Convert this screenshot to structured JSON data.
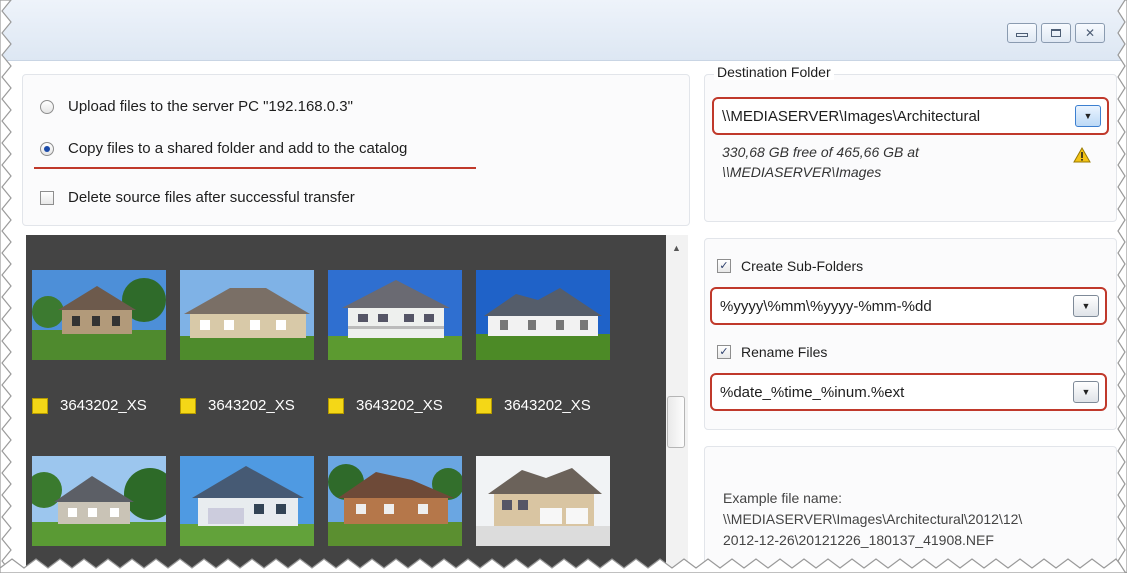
{
  "window": {
    "controls": {
      "minimize": "minimize-icon",
      "maximize": "maximize-icon",
      "close": "close-icon"
    }
  },
  "options": {
    "upload_label": "Upload files to the server PC \"192.168.0.3\"",
    "copy_label": "Copy files to a shared folder and add to the catalog",
    "delete_label": "Delete source files after successful transfer",
    "selected": "copy"
  },
  "gallery": {
    "items": [
      {
        "caption": "3643202_XS"
      },
      {
        "caption": "3643202_XS"
      },
      {
        "caption": "3643202_XS"
      },
      {
        "caption": "3643202_XS"
      }
    ]
  },
  "destination": {
    "group_label": "Destination Folder",
    "path": "\\\\MEDIASERVER\\Images\\Architectural",
    "free_space_line1": "330,68 GB free of 465,66 GB at",
    "free_space_line2": "\\\\MEDIASERVER\\Images"
  },
  "subfolders": {
    "create_label": "Create Sub-Folders",
    "create_checked": true,
    "pattern": "%yyyy\\%mm\\%yyyy-%mm-%dd",
    "rename_label": "Rename Files",
    "rename_checked": true,
    "rename_pattern": "%date_%time_%inum.%ext"
  },
  "example": {
    "label": "Example file name:",
    "line1": "\\\\MEDIASERVER\\Images\\Architectural\\2012\\12\\",
    "line2": "2012-12-26\\20121226_180137_41908.NEF"
  },
  "colors": {
    "highlight": "#c0392b",
    "gallery_bg": "#444444",
    "caption_square": "#f4d717"
  }
}
